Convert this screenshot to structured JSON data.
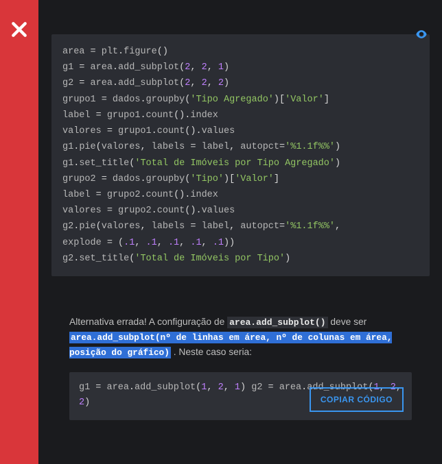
{
  "close": {
    "icon": "close"
  },
  "eye": {
    "icon": "eye"
  },
  "code1_lines": [
    [
      [
        "n",
        "area"
      ],
      [
        "p",
        " = "
      ],
      [
        "n",
        "plt"
      ],
      [
        "p",
        "."
      ],
      [
        "n",
        "figure"
      ],
      [
        "p",
        "()"
      ]
    ],
    [
      [
        "n",
        "g1"
      ],
      [
        "p",
        " = "
      ],
      [
        "n",
        "area"
      ],
      [
        "p",
        "."
      ],
      [
        "n",
        "add_subplot"
      ],
      [
        "p",
        "("
      ],
      [
        "m",
        "2"
      ],
      [
        "p",
        ", "
      ],
      [
        "m",
        "2"
      ],
      [
        "p",
        ", "
      ],
      [
        "m",
        "1"
      ],
      [
        "p",
        ")"
      ]
    ],
    [
      [
        "n",
        "g2"
      ],
      [
        "p",
        " = "
      ],
      [
        "n",
        "area"
      ],
      [
        "p",
        "."
      ],
      [
        "n",
        "add_subplot"
      ],
      [
        "p",
        "("
      ],
      [
        "m",
        "2"
      ],
      [
        "p",
        ", "
      ],
      [
        "m",
        "2"
      ],
      [
        "p",
        ", "
      ],
      [
        "m",
        "2"
      ],
      [
        "p",
        ")"
      ]
    ],
    [
      [
        "n",
        "grupo1"
      ],
      [
        "p",
        " = "
      ],
      [
        "n",
        "dados"
      ],
      [
        "p",
        "."
      ],
      [
        "n",
        "groupby"
      ],
      [
        "p",
        "("
      ],
      [
        "s",
        "'Tipo Agregado'"
      ],
      [
        "p",
        ")["
      ],
      [
        "s",
        "'Valor'"
      ],
      [
        "p",
        "]"
      ]
    ],
    [
      [
        "n",
        "label"
      ],
      [
        "p",
        " = "
      ],
      [
        "n",
        "grupo1"
      ],
      [
        "p",
        "."
      ],
      [
        "n",
        "count"
      ],
      [
        "p",
        "()."
      ],
      [
        "n",
        "index"
      ]
    ],
    [
      [
        "n",
        "valores"
      ],
      [
        "p",
        " = "
      ],
      [
        "n",
        "grupo1"
      ],
      [
        "p",
        "."
      ],
      [
        "n",
        "count"
      ],
      [
        "p",
        "()."
      ],
      [
        "n",
        "values"
      ]
    ],
    [
      [
        "n",
        "g1"
      ],
      [
        "p",
        "."
      ],
      [
        "n",
        "pie"
      ],
      [
        "p",
        "("
      ],
      [
        "n",
        "valores"
      ],
      [
        "p",
        ", "
      ],
      [
        "n",
        "labels"
      ],
      [
        "p",
        " = "
      ],
      [
        "n",
        "label"
      ],
      [
        "p",
        ", "
      ],
      [
        "n",
        "autopct"
      ],
      [
        "p",
        "="
      ],
      [
        "s",
        "'%1.1f%%'"
      ],
      [
        "p",
        ")"
      ]
    ],
    [
      [
        "n",
        "g1"
      ],
      [
        "p",
        "."
      ],
      [
        "n",
        "set_title"
      ],
      [
        "p",
        "("
      ],
      [
        "s",
        "'Total de Imóveis por Tipo Agregado'"
      ],
      [
        "p",
        ")"
      ]
    ],
    [
      [
        "n",
        "grupo2"
      ],
      [
        "p",
        " = "
      ],
      [
        "n",
        "dados"
      ],
      [
        "p",
        "."
      ],
      [
        "n",
        "groupby"
      ],
      [
        "p",
        "("
      ],
      [
        "s",
        "'Tipo'"
      ],
      [
        "p",
        ")["
      ],
      [
        "s",
        "'Valor'"
      ],
      [
        "p",
        "]"
      ]
    ],
    [
      [
        "n",
        "label"
      ],
      [
        "p",
        " = "
      ],
      [
        "n",
        "grupo2"
      ],
      [
        "p",
        "."
      ],
      [
        "n",
        "count"
      ],
      [
        "p",
        "()."
      ],
      [
        "n",
        "index"
      ]
    ],
    [
      [
        "n",
        "valores"
      ],
      [
        "p",
        " = "
      ],
      [
        "n",
        "grupo2"
      ],
      [
        "p",
        "."
      ],
      [
        "n",
        "count"
      ],
      [
        "p",
        "()."
      ],
      [
        "n",
        "values"
      ]
    ],
    [
      [
        "n",
        "g2"
      ],
      [
        "p",
        "."
      ],
      [
        "n",
        "pie"
      ],
      [
        "p",
        "("
      ],
      [
        "n",
        "valores"
      ],
      [
        "p",
        ", "
      ],
      [
        "n",
        "labels"
      ],
      [
        "p",
        " = "
      ],
      [
        "n",
        "label"
      ],
      [
        "p",
        ", "
      ],
      [
        "n",
        "autopct"
      ],
      [
        "p",
        "="
      ],
      [
        "s",
        "'%1.1f%%'"
      ],
      [
        "p",
        ","
      ]
    ],
    [
      [
        "n",
        "explode"
      ],
      [
        "p",
        " = ("
      ],
      [
        "m",
        ".1"
      ],
      [
        "p",
        ", "
      ],
      [
        "m",
        ".1"
      ],
      [
        "p",
        ", "
      ],
      [
        "m",
        ".1"
      ],
      [
        "p",
        ", "
      ],
      [
        "m",
        ".1"
      ],
      [
        "p",
        ", "
      ],
      [
        "m",
        ".1"
      ],
      [
        "p",
        "))"
      ]
    ],
    [
      [
        "n",
        "g2"
      ],
      [
        "p",
        "."
      ],
      [
        "n",
        "set_title"
      ],
      [
        "p",
        "("
      ],
      [
        "s",
        "'Total de Imóveis por Tipo'"
      ],
      [
        "p",
        ")"
      ]
    ]
  ],
  "explain": {
    "t1": "Alternativa errada! A configuração de ",
    "inline": "area.add_subplot()",
    "t2": " deve ser ",
    "hl": "area.add_subplot(nº de linhas em área, nº de colunas em área, posição do gráfico)",
    "t3": " . Neste caso seria:"
  },
  "code2_lines": [
    [
      [
        "n",
        "g1"
      ],
      [
        "p",
        " = "
      ],
      [
        "n",
        "area"
      ],
      [
        "p",
        "."
      ],
      [
        "n",
        "add_subplot"
      ],
      [
        "p",
        "("
      ],
      [
        "m",
        "1"
      ],
      [
        "p",
        ", "
      ],
      [
        "m",
        "2"
      ],
      [
        "p",
        ", "
      ],
      [
        "m",
        "1"
      ],
      [
        "p",
        ")"
      ]
    ],
    [
      [
        "n",
        "g2"
      ],
      [
        "p",
        " = "
      ],
      [
        "n",
        "area"
      ],
      [
        "p",
        "."
      ],
      [
        "n",
        "add_subplot"
      ],
      [
        "p",
        "("
      ],
      [
        "m",
        "1"
      ],
      [
        "p",
        ", "
      ],
      [
        "m",
        "2"
      ],
      [
        "p",
        ", "
      ],
      [
        "m",
        "2"
      ],
      [
        "p",
        ")"
      ]
    ]
  ],
  "copy_label": "COPIAR CÓDIGO"
}
